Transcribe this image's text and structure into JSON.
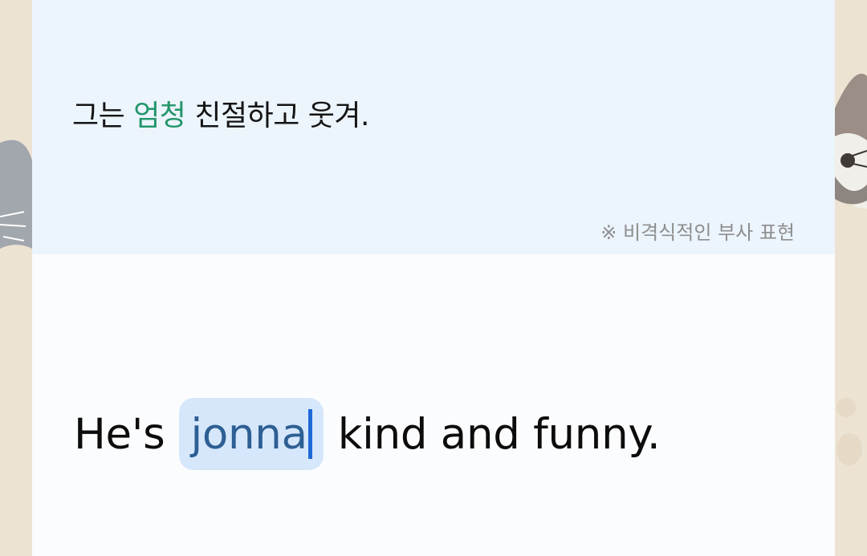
{
  "colors": {
    "wallpaper": "#ede3d3",
    "prompt_background": "#ecf4fc",
    "answer_background": "#fbfcfd",
    "highlight_word": "#23966a",
    "input_background": "#d6e7fb",
    "input_text": "#2d5f93",
    "caret": "#1f68d8",
    "note_text": "#8e8e8e"
  },
  "prompt": {
    "before": "그는 ",
    "highlight": "엄청",
    "after": " 친절하고 웃겨.",
    "note": "※ 비격식적인 부사 표현"
  },
  "answer": {
    "before": "He's",
    "input_value": "jonna",
    "after": "kind and funny."
  },
  "decorations": {
    "left": "cat-face-icon",
    "right": "cat-face-icon"
  }
}
